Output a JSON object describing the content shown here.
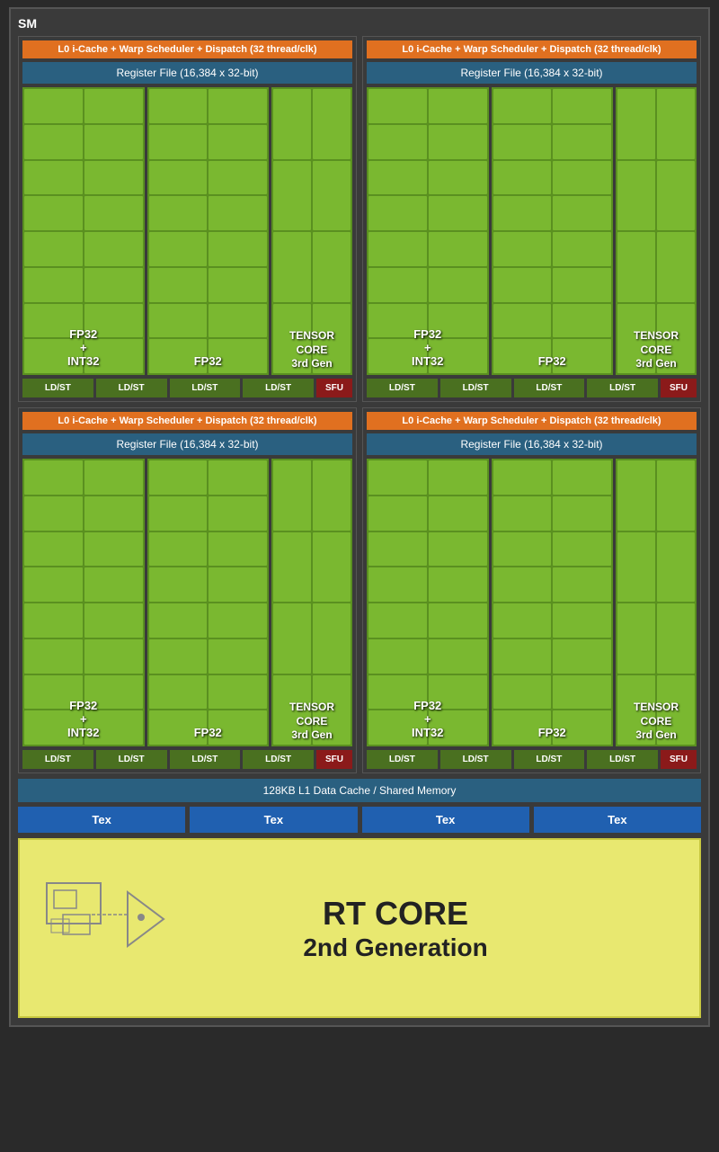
{
  "sm": {
    "label": "SM",
    "quadrants": [
      {
        "id": "q1",
        "l0_label": "L0 i-Cache + Warp Scheduler + Dispatch (32 thread/clk)",
        "register_label": "Register File (16,384 x 32-bit)",
        "fp32_int32_label": "FP32\n+\nINT32",
        "fp32_label": "FP32",
        "tensor_label": "TENSOR\nCORE\n3rd Gen",
        "ldst_labels": [
          "LD/ST",
          "LD/ST",
          "LD/ST",
          "LD/ST"
        ],
        "sfu_label": "SFU"
      },
      {
        "id": "q2",
        "l0_label": "L0 i-Cache + Warp Scheduler + Dispatch (32 thread/clk)",
        "register_label": "Register File (16,384 x 32-bit)",
        "fp32_int32_label": "FP32\n+\nINT32",
        "fp32_label": "FP32",
        "tensor_label": "TENSOR\nCORE\n3rd Gen",
        "ldst_labels": [
          "LD/ST",
          "LD/ST",
          "LD/ST",
          "LD/ST"
        ],
        "sfu_label": "SFU"
      },
      {
        "id": "q3",
        "l0_label": "L0 i-Cache + Warp Scheduler + Dispatch (32 thread/clk)",
        "register_label": "Register File (16,384 x 32-bit)",
        "fp32_int32_label": "FP32\n+\nINT32",
        "fp32_label": "FP32",
        "tensor_label": "TENSOR\nCORE\n3rd Gen",
        "ldst_labels": [
          "LD/ST",
          "LD/ST",
          "LD/ST",
          "LD/ST"
        ],
        "sfu_label": "SFU"
      },
      {
        "id": "q4",
        "l0_label": "L0 i-Cache + Warp Scheduler + Dispatch (32 thread/clk)",
        "register_label": "Register File (16,384 x 32-bit)",
        "fp32_int32_label": "FP32\n+\nINT32",
        "fp32_label": "FP32",
        "tensor_label": "TENSOR\nCORE\n3rd Gen",
        "ldst_labels": [
          "LD/ST",
          "LD/ST",
          "LD/ST",
          "LD/ST"
        ],
        "sfu_label": "SFU"
      }
    ],
    "l1_cache_label": "128KB L1 Data Cache / Shared Memory",
    "tex_labels": [
      "Tex",
      "Tex",
      "Tex",
      "Tex"
    ],
    "rt_core_title": "RT CORE",
    "rt_core_subtitle": "2nd Generation"
  }
}
